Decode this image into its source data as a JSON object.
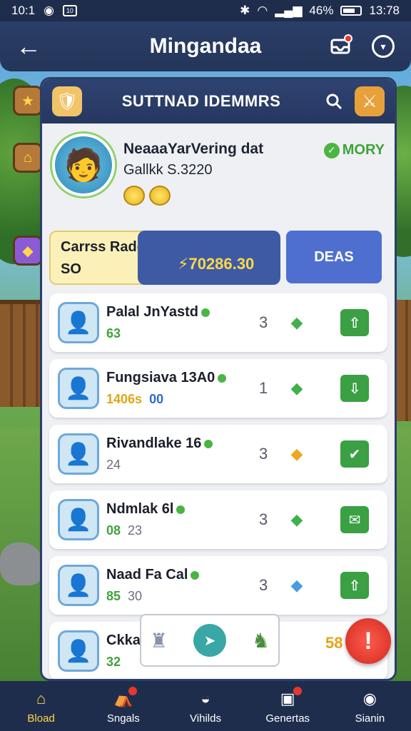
{
  "status_bar": {
    "time_left": "10:1",
    "box_label": "10",
    "battery": "46%",
    "time_right": "13:78"
  },
  "header": {
    "title": "Mingandaa"
  },
  "panel": {
    "title": "SUTTNAD IDEMMRS"
  },
  "profile": {
    "name": "NeaaaYarVering dat",
    "subtitle": "Gallkk S.3220",
    "status": "MORY"
  },
  "balance": {
    "label": "Carrss Raddvnk",
    "small_value": "SO",
    "amount": "70286.30",
    "deals_label": "DEAS"
  },
  "list": [
    {
      "name": "Palal JnYastd",
      "meta1": "63",
      "meta2": "",
      "count": "3",
      "gem": "green",
      "action": "arrow-up"
    },
    {
      "name": "Fungsiava 13A0",
      "meta1": "1406s",
      "meta2": "00",
      "count": "1",
      "gem": "green",
      "action": "arrow-down"
    },
    {
      "name": "Rivandlake 16",
      "meta1": "",
      "meta2": "24",
      "count": "3",
      "gem": "orange",
      "action": "check"
    },
    {
      "name": "Ndmlak 6l",
      "meta1": "08",
      "meta2": "23",
      "count": "3",
      "gem": "green",
      "action": "note"
    },
    {
      "name": "Naad Fa Cal",
      "meta1": "85",
      "meta2": "30",
      "count": "3",
      "gem": "blue",
      "action": "arrow-up"
    },
    {
      "name": "Ckkan",
      "meta1": "32",
      "meta2": "",
      "count": "",
      "gem": "",
      "action": ""
    }
  ],
  "peek_price": "58",
  "bottom_nav": [
    {
      "label": "Bload",
      "icon": "home-icon",
      "active": true
    },
    {
      "label": "Sngals",
      "icon": "shop-icon",
      "active": false
    },
    {
      "label": "Vihilds",
      "icon": "food-icon",
      "active": false
    },
    {
      "label": "Genertas",
      "icon": "chest-icon",
      "active": false
    },
    {
      "label": "Sianin",
      "icon": "profile-icon",
      "active": false
    }
  ],
  "colors": {
    "accent": "#2b3e68",
    "gold": "#ffd84a",
    "success": "#3aa043",
    "alert": "#d12b22"
  }
}
